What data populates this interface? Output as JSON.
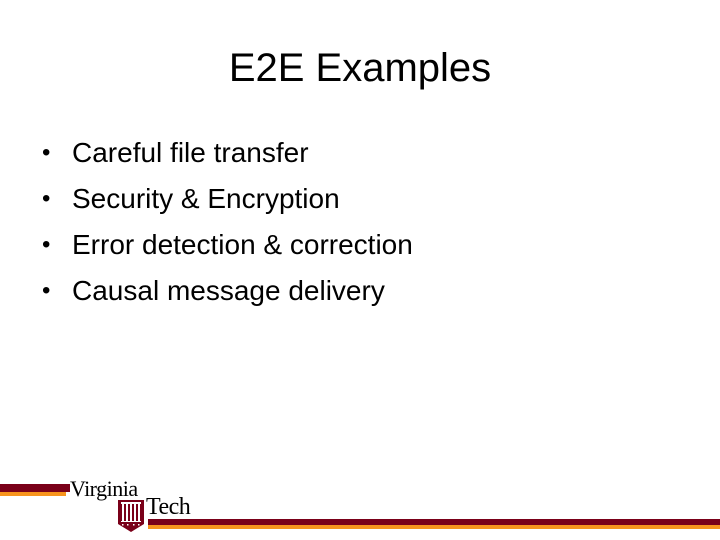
{
  "slide": {
    "title": "E2E Examples",
    "bullets": [
      "Careful file transfer",
      "Security & Encryption",
      "Error detection & correction",
      "Causal message delivery"
    ],
    "bullet_glyph": "•"
  },
  "footer": {
    "logo": {
      "line1": "Virginia",
      "line2": "Tech",
      "shield_icon": "vt-shield-icon"
    },
    "colors": {
      "maroon": "#7a0019",
      "orange": "#f7941d"
    }
  }
}
